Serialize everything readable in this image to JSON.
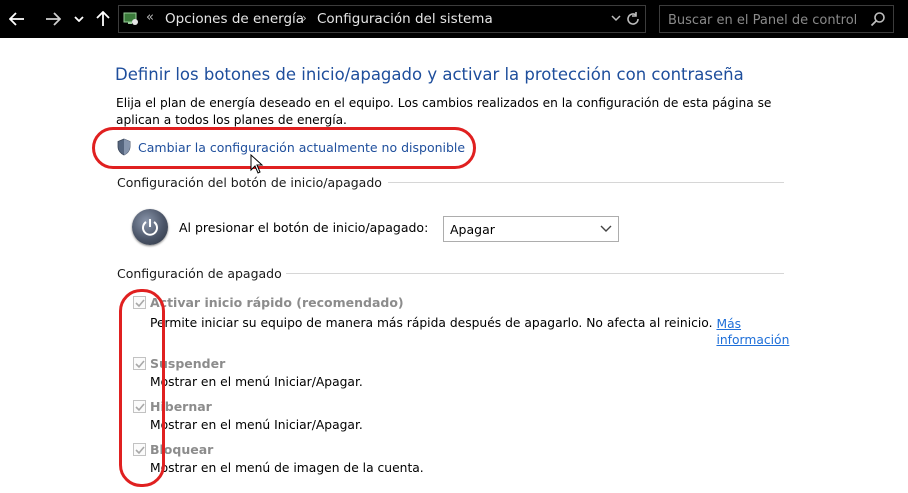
{
  "address_bar": {
    "breadcrumb_sep_start": "«",
    "crumbs": [
      "Opciones de energía",
      "Configuración del sistema"
    ],
    "search_placeholder": "Buscar en el Panel de control"
  },
  "page": {
    "title": "Definir los botones de inicio/apagado y activar la protección con contraseña",
    "description": "Elija el plan de energía deseado en el equipo. Los cambios realizados en la configuración de esta página se aplican a todos los planes de energía.",
    "unavailable_link": "Cambiar la configuración actualmente no disponible"
  },
  "power_button_section": {
    "heading": "Configuración del botón de inicio/apagado",
    "label": "Al presionar el botón de inicio/apagado:",
    "selected": "Apagar"
  },
  "shutdown_section": {
    "heading": "Configuración de apagado",
    "options": [
      {
        "label": "Activar inicio rápido (recomendado)",
        "desc": "Permite iniciar su equipo de manera más rápida después de apagarlo. No afecta al reinicio.",
        "link": "Más información",
        "checked": true
      },
      {
        "label": "Suspender",
        "desc": "Mostrar en el menú Iniciar/Apagar.",
        "checked": true
      },
      {
        "label": "Hibernar",
        "desc": "Mostrar en el menú Iniciar/Apagar.",
        "checked": true
      },
      {
        "label": "Bloquear",
        "desc": "Mostrar en el menú de imagen de la cuenta.",
        "checked": true
      }
    ]
  },
  "colors": {
    "accent": "#1e4e9c",
    "link": "#1e6fd9",
    "highlight": "#e02020"
  }
}
